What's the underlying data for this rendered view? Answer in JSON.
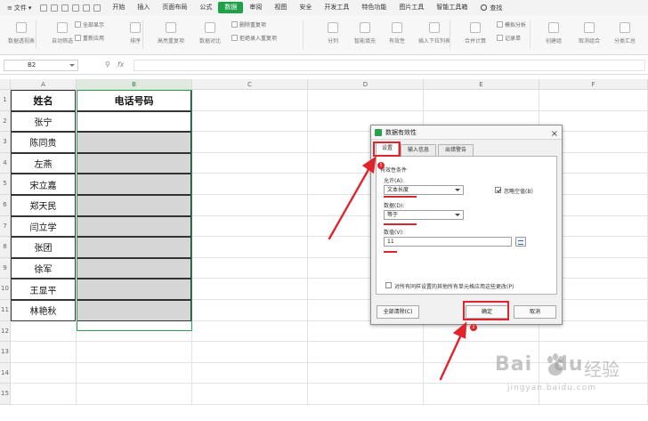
{
  "menubar": {
    "file_label": "文件",
    "tabs": [
      {
        "label": "开始",
        "active": false
      },
      {
        "label": "插入",
        "active": false
      },
      {
        "label": "页面布局",
        "active": false
      },
      {
        "label": "公式",
        "active": false
      },
      {
        "label": "数据",
        "active": true
      },
      {
        "label": "审阅",
        "active": false
      },
      {
        "label": "视图",
        "active": false
      },
      {
        "label": "安全",
        "active": false
      },
      {
        "label": "开发工具",
        "active": false
      },
      {
        "label": "特色功能",
        "active": false
      },
      {
        "label": "图片工具",
        "active": false
      },
      {
        "label": "智能工具箱",
        "active": false
      }
    ],
    "search_label": "查找",
    "accent_color": "#1fa14a"
  },
  "ribbon": {
    "items": [
      "数据透视表",
      "自动筛选",
      "全部显示",
      "重新应用",
      "排序",
      "高亮重复项",
      "数据对比",
      "删除重复项",
      "拒绝录入重复项",
      "分列",
      "智能填充",
      "有效性",
      "插入下拉列表",
      "合并计算",
      "模拟分析",
      "记录单",
      "创建组",
      "取消组合",
      "分类汇总"
    ]
  },
  "formula_bar": {
    "cell_ref": "B2",
    "fx_label": "fx",
    "formula": ""
  },
  "grid": {
    "columns": [
      "A",
      "B",
      "C",
      "D",
      "E",
      "F"
    ],
    "rows": [
      "1",
      "2",
      "3",
      "4",
      "5",
      "6",
      "7",
      "8",
      "9",
      "10",
      "11",
      "12",
      "13",
      "14",
      "15"
    ],
    "header_name": "姓名",
    "header_phone": "电话号码",
    "names": [
      "张宁",
      "陈同贵",
      "左燕",
      "宋立嘉",
      "郑天民",
      "闫立学",
      "张团",
      "徐军",
      "王显平",
      "林艳秋"
    ],
    "selection_color": "#2e9e4e"
  },
  "dialog": {
    "title": "数据有效性",
    "tabs": [
      "设置",
      "输入信息",
      "出错警告"
    ],
    "section_label": "有效性条件",
    "allow_label": "允许(A):",
    "allow_value": "文本长度",
    "ignore_blank_label": "忽略空值(B)",
    "ignore_blank_checked": true,
    "data_label": "数据(D):",
    "data_value": "等于",
    "value_label": "数值(V):",
    "value": "11",
    "apply_all_label": "对所有同样设置的其他所有单元格应用这些更改(P)",
    "apply_all_checked": false,
    "clear_all_label": "全部清除(C)",
    "ok_label": "确定",
    "cancel_label": "取消"
  },
  "annotations": {
    "badge_1": "1",
    "badge_2": "2",
    "color": "#e0242b"
  },
  "watermark": {
    "brand": "Bai",
    "brand_tail": "du",
    "cn": "经验",
    "url": "jingyan.baidu.com"
  }
}
